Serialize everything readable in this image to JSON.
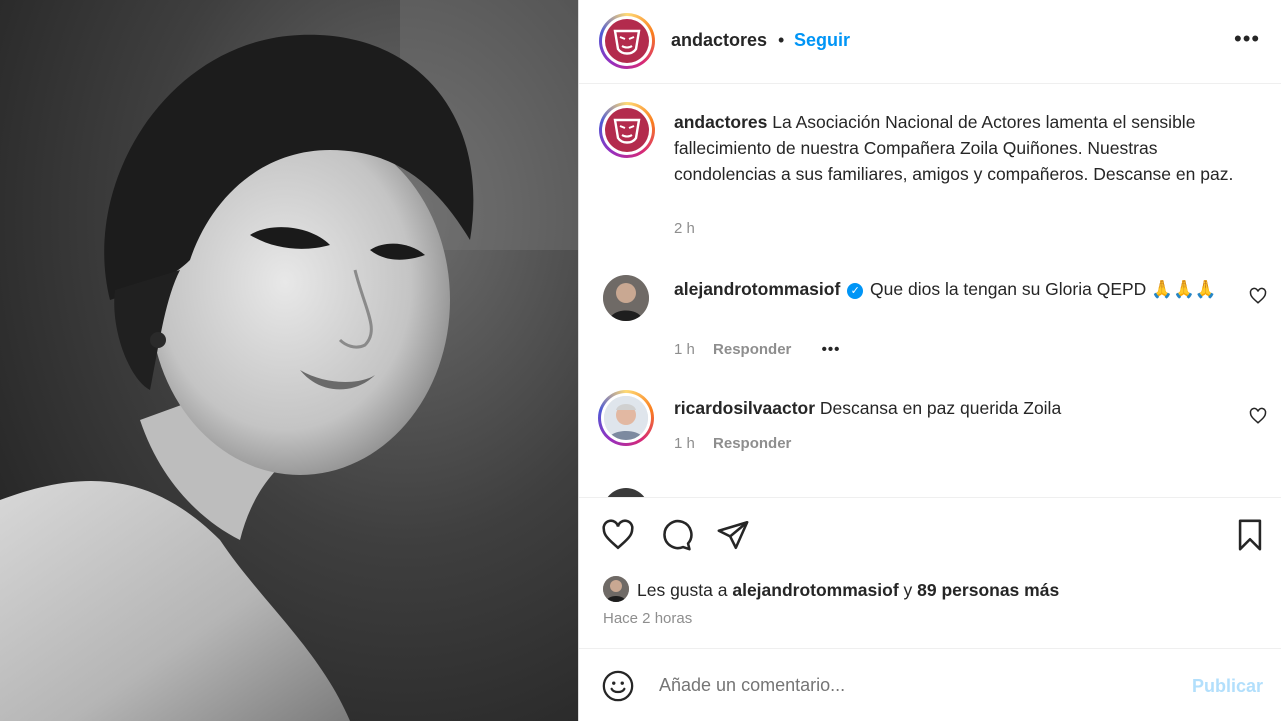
{
  "header": {
    "username": "andactores",
    "separator": "•",
    "follow_label": "Seguir",
    "more_label": "•••"
  },
  "caption": {
    "username": "andactores",
    "text": "La Asociación Nacional de Actores lamenta el sensible fallecimiento de nuestra Compañera Zoila Quiñones. Nuestras condolencias a sus familiares, amigos y compañeros. Descanse en paz.",
    "time": "2 h"
  },
  "comments": [
    {
      "username": "alejandrotommasiof",
      "verified": true,
      "text": "Que dios la tengan su Gloria QEPD 🙏🙏🙏",
      "time": "1 h",
      "reply_label": "Responder",
      "more_label": "•••"
    },
    {
      "username": "ricardosilvaactor",
      "verified": false,
      "text": "Descansa en paz querida Zoila",
      "time": "1 h",
      "reply_label": "Responder"
    }
  ],
  "likes": {
    "prefix": "Les gusta a",
    "user": "alejandrotommasiof",
    "joiner": "y",
    "others": "89 personas más",
    "ago": "Hace 2 horas"
  },
  "add_comment": {
    "placeholder": "Añade un comentario...",
    "publish_label": "Publicar"
  },
  "icons": [
    "heart-icon",
    "comment-icon",
    "share-icon",
    "bookmark-icon",
    "emoji-icon",
    "more-icon",
    "verified-icon"
  ],
  "colors": {
    "link_blue": "#0095f6",
    "publish_disabled": "#b2dffc",
    "muted_text": "#8e8e8e",
    "brand_logo": "#b32b4d"
  }
}
